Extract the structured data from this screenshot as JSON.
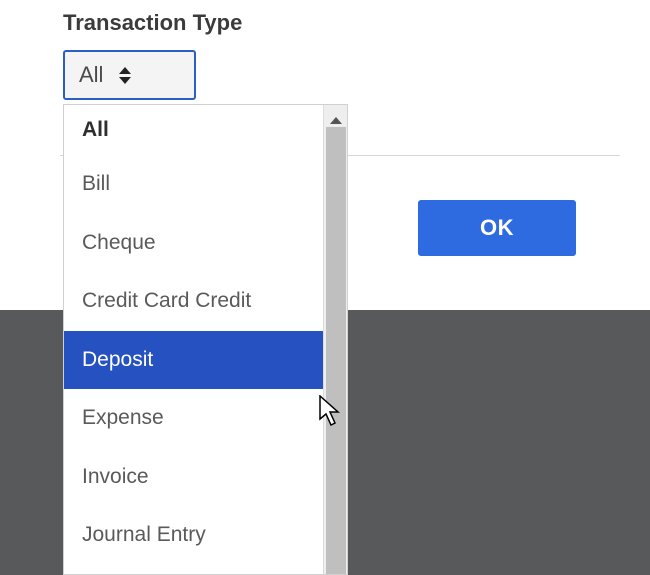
{
  "field": {
    "label": "Transaction Type"
  },
  "select": {
    "value": "All"
  },
  "dropdown": {
    "items": [
      {
        "label": "All"
      },
      {
        "label": "Bill"
      },
      {
        "label": "Cheque"
      },
      {
        "label": "Credit Card Credit"
      },
      {
        "label": "Deposit"
      },
      {
        "label": "Expense"
      },
      {
        "label": "Invoice"
      },
      {
        "label": "Journal Entry"
      }
    ],
    "highlighted_index": 4
  },
  "buttons": {
    "ok": "OK"
  }
}
